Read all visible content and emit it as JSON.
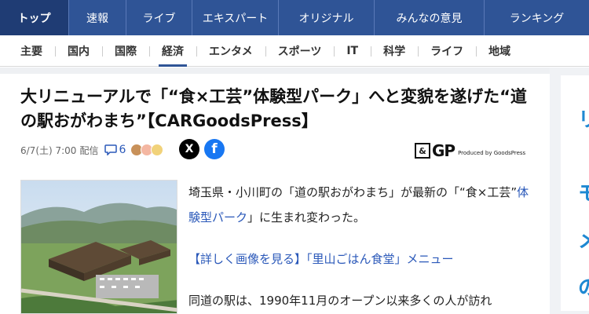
{
  "topnav": {
    "tabs": [
      {
        "label": "トップ",
        "active": true
      },
      {
        "label": "速報"
      },
      {
        "label": "ライブ"
      },
      {
        "label": "エキスパート"
      },
      {
        "label": "オリジナル"
      },
      {
        "label": "みんなの意見"
      },
      {
        "label": "ランキング"
      }
    ]
  },
  "subnav": {
    "items": [
      {
        "label": "主要"
      },
      {
        "label": "国内"
      },
      {
        "label": "国際"
      },
      {
        "label": "経済",
        "active": true
      },
      {
        "label": "エンタメ"
      },
      {
        "label": "スポーツ"
      },
      {
        "label": "IT"
      },
      {
        "label": "科学"
      },
      {
        "label": "ライフ"
      },
      {
        "label": "地域"
      }
    ]
  },
  "article": {
    "headline": "大リニューアルで「“食×工芸”体験型パーク」へと変貌を遂げた“道の駅おがわまち”【CARGoodsPress】",
    "date": "6/7(土) 7:00",
    "date_suffix": "配信",
    "comment_count": "6",
    "share_x": "X",
    "share_fb": "f",
    "publisher": {
      "mark": "&",
      "name": "GP",
      "tagline": "Produced by GoodsPress"
    },
    "para1_a": "埼玉県・小川町の「道の駅おがわまち」が最新の「“食×工芸”",
    "para1_link": "体験型パーク",
    "para1_b": "」に生まれ変わった。",
    "link2": "【詳しく画像を見る】「里山ごはん食堂」メニュー",
    "para3": "同道の駅は、1990年11月のオープン以来多くの人が訪れ"
  },
  "rightad": {
    "glyph1": "リ",
    "glyph2": "モ",
    "glyph3": "メ",
    "glyph4": "の"
  },
  "colors": {
    "nav": "#2f5496",
    "link": "#2a58b9",
    "fb": "#1877f2"
  }
}
